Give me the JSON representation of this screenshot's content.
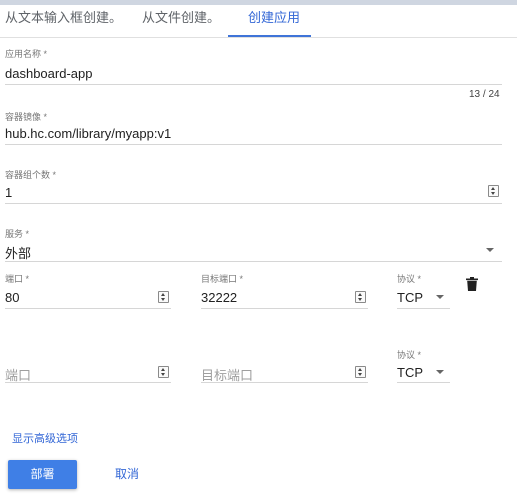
{
  "tabs": [
    {
      "label": "从文本输入框创建。"
    },
    {
      "label": "从文件创建。"
    },
    {
      "label": "创建应用"
    }
  ],
  "app_name": {
    "label": "应用名称 *",
    "value": "dashboard-app",
    "counter": "13 / 24"
  },
  "image": {
    "label": "容器镜像 *",
    "value": "hub.hc.com/library/myapp:v1"
  },
  "pods": {
    "label": "容器组个数 *",
    "value": "1"
  },
  "service": {
    "label": "服务 *",
    "value": "外部"
  },
  "port_row_1": {
    "port_label": "端口 *",
    "port_value": "80",
    "target_label": "目标端口 *",
    "target_value": "32222",
    "protocol_label": "协议 *",
    "protocol_value": "TCP"
  },
  "port_row_2": {
    "port_placeholder": "端口",
    "target_placeholder": "目标端口",
    "protocol_label": "协议 *",
    "protocol_value": "TCP"
  },
  "advanced_link": "显示高级选项",
  "buttons": {
    "deploy": "部署",
    "cancel": "取消"
  },
  "colors": {
    "accent": "#3f7fe6",
    "link": "#3367d6",
    "tab_ink": "#3f74d8"
  },
  "icons": {
    "delete": "trash-icon",
    "dropdown": "caret-down-icon",
    "spinner": "number-spinner-icon"
  }
}
